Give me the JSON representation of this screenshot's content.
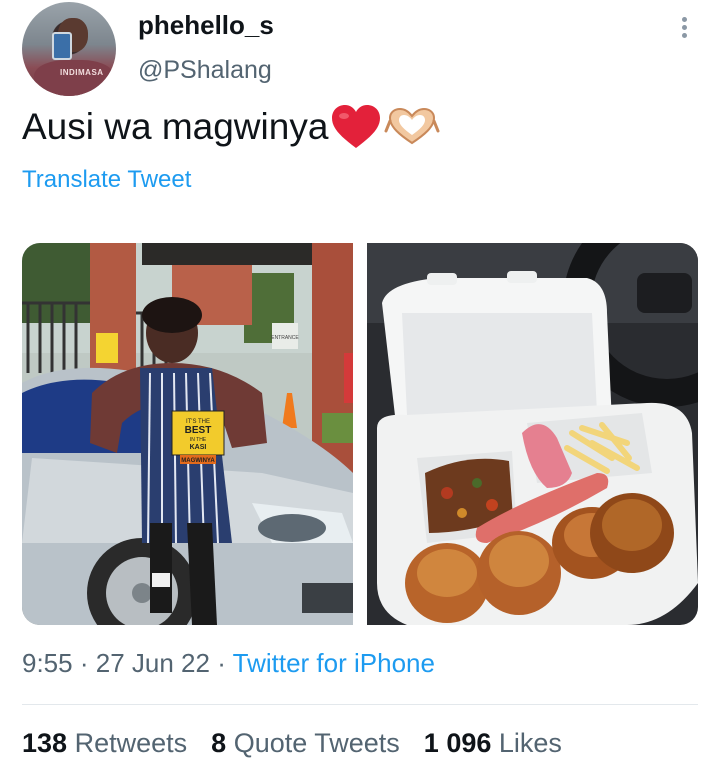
{
  "user": {
    "display_name": "phehello_s",
    "handle": "@PShalang",
    "avatar_shirt_text": "INDIMASA"
  },
  "tweet": {
    "text": "Ausi wa magwinya",
    "emojis": [
      "red-heart",
      "heart-hands"
    ]
  },
  "translate_label": "Translate Tweet",
  "media": {
    "left_apron_text": [
      "IT'S THE",
      "BEST",
      "IN THE",
      "KASI",
      "MAGWINYA"
    ],
    "left_sign_text": "ENTRANCE"
  },
  "meta": {
    "time": "9:55",
    "separator": "·",
    "date": "27 Jun 22",
    "source": "Twitter for iPhone"
  },
  "stats": {
    "retweets_count": "138",
    "retweets_label": "Retweets",
    "quotes_count": "8",
    "quotes_label": "Quote Tweets",
    "likes_count": "1 096",
    "likes_label": "Likes"
  },
  "colors": {
    "link": "#1d9bf0",
    "secondary_text": "#536471",
    "primary_text": "#0f1419"
  }
}
